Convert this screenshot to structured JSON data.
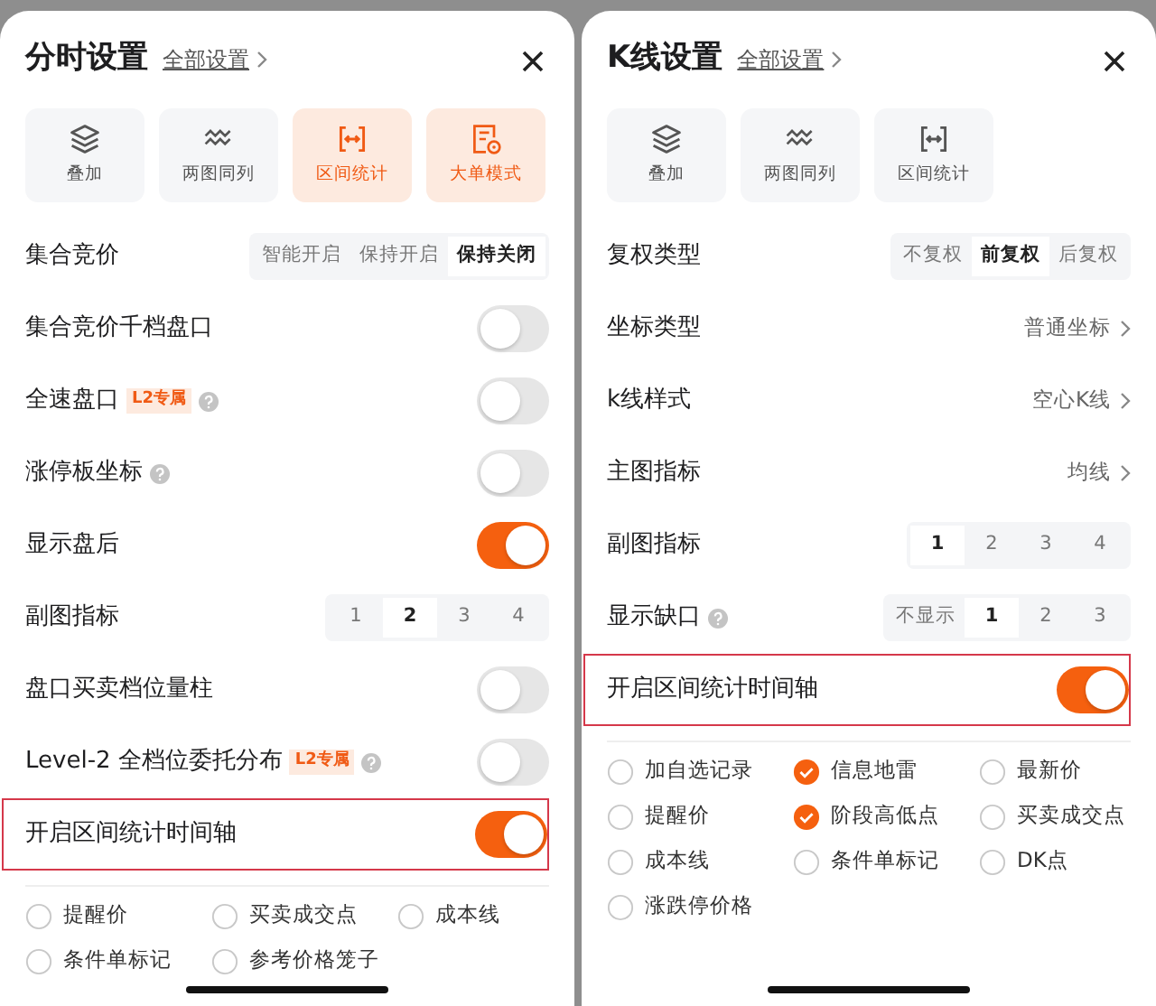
{
  "panels": [
    {
      "title": "分时设置",
      "all_settings": "全部设置",
      "tiles": [
        {
          "label": "叠加",
          "selected": false
        },
        {
          "label": "两图同列",
          "selected": false
        },
        {
          "label": "区间统计",
          "selected": true
        },
        {
          "label": "大单模式",
          "selected": true
        }
      ],
      "settings": [
        {
          "kind": "segmented",
          "label": "集合竞价",
          "options": [
            {
              "label": "智能开启",
              "selected": false
            },
            {
              "label": "保持开启",
              "selected": false
            },
            {
              "label": "保持关闭",
              "selected": true
            }
          ]
        },
        {
          "kind": "toggle",
          "label": "集合竞价千档盘口",
          "on": false
        },
        {
          "kind": "toggle",
          "label": "全速盘口",
          "badge": "L2专属",
          "help": true,
          "on": false
        },
        {
          "kind": "toggle",
          "label": "涨停板坐标",
          "help": true,
          "on": false
        },
        {
          "kind": "toggle",
          "label": "显示盘后",
          "on": true
        },
        {
          "kind": "segmented",
          "label": "副图指标",
          "options": [
            {
              "label": "1",
              "selected": false
            },
            {
              "label": "2",
              "selected": true
            },
            {
              "label": "3",
              "selected": false
            },
            {
              "label": "4",
              "selected": false
            }
          ]
        },
        {
          "kind": "toggle",
          "label": "盘口买卖档位量柱",
          "on": false
        },
        {
          "kind": "toggle",
          "label": "Level-2 全档位委托分布",
          "badge": "L2专属",
          "help": true,
          "on": false
        },
        {
          "kind": "toggle",
          "label": "开启区间统计时间轴",
          "on": true,
          "highlighted": true
        }
      ],
      "checks": [
        {
          "label": "提醒价",
          "checked": false
        },
        {
          "label": "买卖成交点",
          "checked": false
        },
        {
          "label": "成本线",
          "checked": false
        },
        {
          "label": "条件单标记",
          "checked": false
        },
        {
          "label": "参考价格笼子",
          "checked": false
        }
      ]
    },
    {
      "title": "K线设置",
      "all_settings": "全部设置",
      "tiles": [
        {
          "label": "叠加",
          "selected": false
        },
        {
          "label": "两图同列",
          "selected": false
        },
        {
          "label": "区间统计",
          "selected": false
        }
      ],
      "settings": [
        {
          "kind": "segmented",
          "label": "复权类型",
          "options": [
            {
              "label": "不复权",
              "selected": false
            },
            {
              "label": "前复权",
              "selected": true
            },
            {
              "label": "后复权",
              "selected": false
            }
          ]
        },
        {
          "kind": "link",
          "label": "坐标类型",
          "value": "普通坐标"
        },
        {
          "kind": "link",
          "label": "k线样式",
          "value": "空心K线"
        },
        {
          "kind": "link",
          "label": "主图指标",
          "value": "均线"
        },
        {
          "kind": "segmented",
          "label": "副图指标",
          "options": [
            {
              "label": "1",
              "selected": true
            },
            {
              "label": "2",
              "selected": false
            },
            {
              "label": "3",
              "selected": false
            },
            {
              "label": "4",
              "selected": false
            }
          ]
        },
        {
          "kind": "segmented",
          "label": "显示缺口",
          "help": true,
          "options": [
            {
              "label": "不显示",
              "selected": false
            },
            {
              "label": "1",
              "selected": true
            },
            {
              "label": "2",
              "selected": false
            },
            {
              "label": "3",
              "selected": false
            }
          ]
        },
        {
          "kind": "toggle",
          "label": "开启区间统计时间轴",
          "on": true,
          "highlighted": true
        }
      ],
      "checks": [
        {
          "label": "加自选记录",
          "checked": false
        },
        {
          "label": "信息地雷",
          "checked": true
        },
        {
          "label": "最新价",
          "checked": false
        },
        {
          "label": "提醒价",
          "checked": false
        },
        {
          "label": "阶段高低点",
          "checked": true
        },
        {
          "label": "买卖成交点",
          "checked": false
        },
        {
          "label": "成本线",
          "checked": false
        },
        {
          "label": "条件单标记",
          "checked": false
        },
        {
          "label": "DK点",
          "checked": false
        },
        {
          "label": "涨跌停价格",
          "checked": false
        }
      ]
    }
  ]
}
